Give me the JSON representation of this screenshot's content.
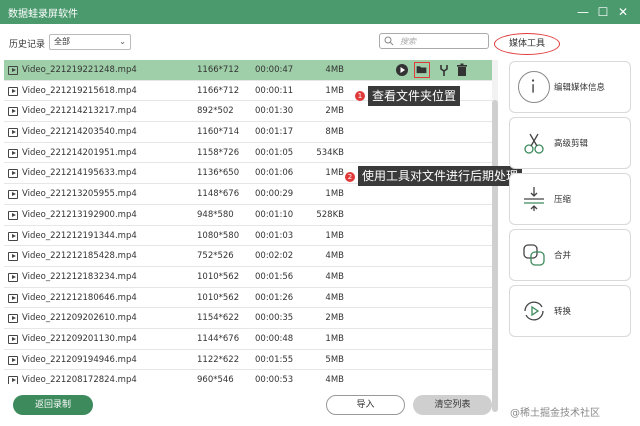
{
  "window": {
    "title": "数据蛙录屏软件",
    "min_glyph": "—",
    "max_glyph": "☐",
    "close_glyph": "✕"
  },
  "toolbar": {
    "history_label": "历史记录",
    "history_value": "全部",
    "search_placeholder": "搜索"
  },
  "media_tools": {
    "tab_label": "媒体工具",
    "items": [
      {
        "label": "编辑媒体信息",
        "icon": "info-icon"
      },
      {
        "label": "高级剪辑",
        "icon": "scissors-icon"
      },
      {
        "label": "压缩",
        "icon": "compress-icon"
      },
      {
        "label": "合并",
        "icon": "merge-icon"
      },
      {
        "label": "转换",
        "icon": "convert-icon"
      }
    ]
  },
  "files": [
    {
      "name": "Video_221219221248.mp4",
      "res": "1166*712",
      "dur": "00:00:47",
      "size": "4MB",
      "selected": true
    },
    {
      "name": "Video_221219215618.mp4",
      "res": "1166*712",
      "dur": "00:00:11",
      "size": "1MB"
    },
    {
      "name": "Video_221214213217.mp4",
      "res": "892*502",
      "dur": "00:01:30",
      "size": "2MB"
    },
    {
      "name": "Video_221214203540.mp4",
      "res": "1160*714",
      "dur": "00:01:17",
      "size": "8MB"
    },
    {
      "name": "Video_221214201951.mp4",
      "res": "1158*726",
      "dur": "00:01:05",
      "size": "534KB"
    },
    {
      "name": "Video_221214195633.mp4",
      "res": "1136*650",
      "dur": "00:01:06",
      "size": "1MB"
    },
    {
      "name": "Video_221213205955.mp4",
      "res": "1148*676",
      "dur": "00:00:29",
      "size": "1MB"
    },
    {
      "name": "Video_221213192900.mp4",
      "res": "948*580",
      "dur": "00:01:10",
      "size": "528KB"
    },
    {
      "name": "Video_221212191344.mp4",
      "res": "1080*580",
      "dur": "00:01:03",
      "size": "1MB"
    },
    {
      "name": "Video_221212185428.mp4",
      "res": "752*526",
      "dur": "00:02:02",
      "size": "4MB"
    },
    {
      "name": "Video_221212183234.mp4",
      "res": "1010*562",
      "dur": "00:01:56",
      "size": "4MB"
    },
    {
      "name": "Video_221212180646.mp4",
      "res": "1010*562",
      "dur": "00:01:26",
      "size": "4MB"
    },
    {
      "name": "Video_221209202610.mp4",
      "res": "1154*622",
      "dur": "00:00:35",
      "size": "2MB"
    },
    {
      "name": "Video_221209201130.mp4",
      "res": "1144*676",
      "dur": "00:00:48",
      "size": "1MB"
    },
    {
      "name": "Video_221209194946.mp4",
      "res": "1122*622",
      "dur": "00:01:55",
      "size": "5MB"
    },
    {
      "name": "Video_221208172824.mp4",
      "res": "960*546",
      "dur": "00:00:53",
      "size": "4MB"
    }
  ],
  "row_actions": {
    "play_icon": "play-icon",
    "folder_icon": "folder-icon",
    "tool_icon": "wrench-icon",
    "delete_icon": "trash-icon"
  },
  "callouts": [
    {
      "number": "1",
      "text": "查看文件夹位置"
    },
    {
      "number": "2",
      "text": "使用工具对文件进行后期处理"
    }
  ],
  "footer": {
    "back_label": "返回录制",
    "import_label": "导入",
    "clear_label": "清空列表"
  },
  "watermark": "@稀土掘金技术社区",
  "colors": {
    "titlebar": "#4a9a6e",
    "selected_row": "#9fcfa8",
    "primary_button": "#3d8a5c",
    "highlight": "#e03a3a"
  }
}
